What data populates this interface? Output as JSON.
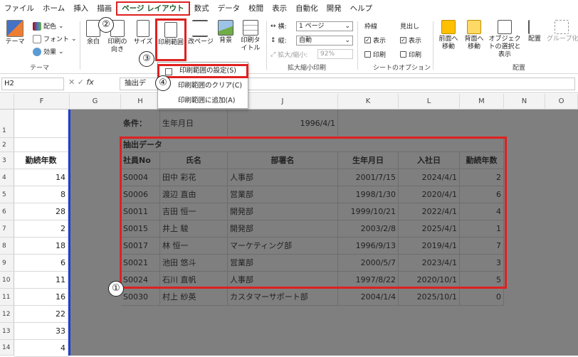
{
  "menu": [
    "ファイル",
    "ホーム",
    "挿入",
    "描画",
    "ページ レイアウト",
    "数式",
    "データ",
    "校閲",
    "表示",
    "自動化",
    "開発",
    "ヘルプ"
  ],
  "ribbon": {
    "theme_label": "テーマ",
    "colors": "配色",
    "fonts": "フォント",
    "effects": "効果",
    "theme_group": "テーマ",
    "margins": "余白",
    "orientation": "印刷の向き",
    "size": "サイズ",
    "print_area": "印刷範囲",
    "breaks": "改ページ",
    "background": "背景",
    "print_titles": "印刷タイトル",
    "width_label": "横:",
    "width_value": "1 ページ",
    "height_label": "縦:",
    "height_value": "自動",
    "scale_label": "拡大/縮小:",
    "scale_value": "92%",
    "fit_group": "拡大縮小印刷",
    "gridlines": "枠線",
    "headings": "見出し",
    "view": "表示",
    "print": "印刷",
    "sheet_options_group": "シートのオプション",
    "bring_forward": "前面へ移動",
    "send_backward": "背面へ移動",
    "selection_pane": "オブジェクトの選択と表示",
    "align": "配置",
    "group": "グループ化",
    "arrange_group": "配置"
  },
  "dropdown": {
    "items": [
      "印刷範囲の設定(S)",
      "印刷範囲のクリア(C)",
      "印刷範囲に追加(A)"
    ]
  },
  "formula_bar": {
    "name_box": "H2",
    "fx": "fx",
    "content": "抽出デ"
  },
  "columns": [
    "F",
    "G",
    "H",
    "I",
    "J",
    "K",
    "L",
    "M",
    "N",
    "O"
  ],
  "rows": [
    "1",
    "2",
    "3",
    "4",
    "5",
    "6",
    "7",
    "8",
    "9",
    "10",
    "11",
    "12",
    "13",
    "14",
    "15",
    "16"
  ],
  "f_column": {
    "header": "勤続年数",
    "values": [
      "14",
      "8",
      "28",
      "2",
      "18",
      "6",
      "11",
      "16",
      "22",
      "33",
      "4",
      "18",
      "13"
    ]
  },
  "condition": {
    "label": "条件：",
    "field": "生年月日",
    "value": "1996/4/1"
  },
  "table": {
    "title": "抽出データ",
    "headers": [
      "社員No",
      "氏名",
      "部署名",
      "生年月日",
      "入社日",
      "勤続年数"
    ],
    "rows": [
      [
        "S0004",
        "田中 彩花",
        "人事部",
        "2001/7/15",
        "2024/4/1",
        "2"
      ],
      [
        "S0006",
        "渡辺 直由",
        "営業部",
        "1998/1/30",
        "2020/4/1",
        "6"
      ],
      [
        "S0011",
        "吉田 恒一",
        "開発部",
        "1999/10/21",
        "2022/4/1",
        "4"
      ],
      [
        "S0015",
        "井上 駿",
        "開発部",
        "2003/2/8",
        "2025/4/1",
        "1"
      ],
      [
        "S0017",
        "林 恒一",
        "マーケティング部",
        "1996/9/13",
        "2019/4/1",
        "7"
      ],
      [
        "S0021",
        "池田 悠斗",
        "営業部",
        "2000/5/7",
        "2023/4/1",
        "3"
      ],
      [
        "S0024",
        "石川 直帆",
        "人事部",
        "1997/8/22",
        "2020/10/1",
        "5"
      ],
      [
        "S0030",
        "村上 紗英",
        "カスタマーサポート部",
        "2004/1/4",
        "2025/10/1",
        "0"
      ]
    ]
  },
  "badges": [
    "①",
    "②",
    "③",
    "④"
  ],
  "colors": {
    "accent_red": "#e02020",
    "ribbon_green": "#1f5c2e",
    "page_gray": "#7f7f7f"
  }
}
